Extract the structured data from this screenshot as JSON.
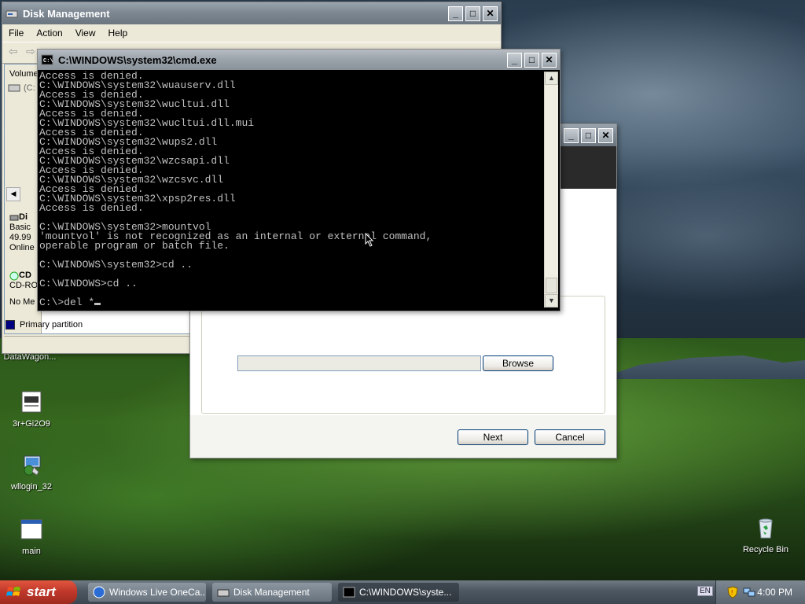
{
  "desktop": {
    "icons": [
      {
        "label": "DataWagon..."
      },
      {
        "label": "3r+Gi2O9"
      },
      {
        "label": "wllogin_32"
      },
      {
        "label": "main"
      },
      {
        "label": "Recycle Bin"
      }
    ]
  },
  "disk_management": {
    "title": "Disk Management",
    "menu": [
      "File",
      "Action",
      "View",
      "Help"
    ],
    "column_volume": "Volume",
    "volume_row": "(C:",
    "disk0": {
      "name": "Di",
      "type": "Basic",
      "size": "49.99",
      "status": "Online"
    },
    "cdrom": {
      "name": "CD",
      "type": "CD-RO",
      "media": "No Me"
    },
    "legend": "Primary partition"
  },
  "wizard": {
    "browse_label": "Browse",
    "next_label": "Next",
    "cancel_label": "Cancel"
  },
  "cmd": {
    "title": "C:\\WINDOWS\\system32\\cmd.exe",
    "lines": [
      "Access is denied.",
      "C:\\WINDOWS\\system32\\wuauserv.dll",
      "Access is denied.",
      "C:\\WINDOWS\\system32\\wucltui.dll",
      "Access is denied.",
      "C:\\WINDOWS\\system32\\wucltui.dll.mui",
      "Access is denied.",
      "C:\\WINDOWS\\system32\\wups2.dll",
      "Access is denied.",
      "C:\\WINDOWS\\system32\\wzcsapi.dll",
      "Access is denied.",
      "C:\\WINDOWS\\system32\\wzcsvc.dll",
      "Access is denied.",
      "C:\\WINDOWS\\system32\\xpsp2res.dll",
      "Access is denied.",
      "",
      "C:\\WINDOWS\\system32>mountvol",
      "'mountvol' is not recognized as an internal or external command,",
      "operable program or batch file.",
      "",
      "C:\\WINDOWS\\system32>cd ..",
      "",
      "C:\\WINDOWS>cd ..",
      "",
      "C:\\>del *"
    ]
  },
  "taskbar": {
    "start_label": "start",
    "tasks": [
      {
        "label": "Windows Live OneCa..."
      },
      {
        "label": "Disk Management"
      },
      {
        "label": "C:\\WINDOWS\\syste..."
      }
    ],
    "tray_lang": "EN",
    "clock": "4:00 PM"
  }
}
